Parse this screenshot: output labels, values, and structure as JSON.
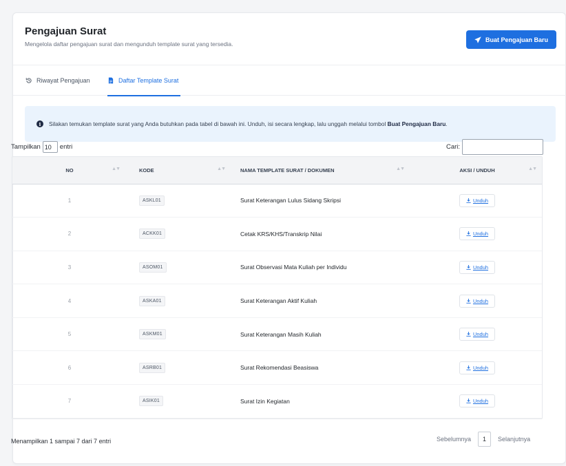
{
  "header": {
    "title": "Pengajuan Surat",
    "subtitle": "Mengelola daftar pengajuan surat dan mengunduh template surat yang tersedia.",
    "new_button_label": "Buat Pengajuan Baru"
  },
  "tabs": [
    {
      "label": "Riwayat Pengajuan",
      "icon": "history-icon",
      "active": false
    },
    {
      "label": "Daftar Template Surat",
      "icon": "document-icon",
      "active": true
    }
  ],
  "alert": {
    "text": "Silakan temukan template surat yang Anda butuhkan pada tabel di bawah ini. Unduh, isi secara lengkap, lalu unggah melalui tombol ",
    "highlight": "Buat Pengajuan Baru",
    "suffix": "."
  },
  "table_controls": {
    "show_label": "Tampilkan",
    "page_length": "10",
    "entries_label": "entri",
    "search_label": "Cari:",
    "search_value": ""
  },
  "table": {
    "columns": [
      "NO",
      "KODE",
      "NAMA TEMPLATE SURAT / DOKUMEN",
      "AKSI / UNDUH"
    ],
    "rows": [
      {
        "no": "1",
        "kode": "ASKL01",
        "nama": "Surat Keterangan Lulus Sidang Skripsi",
        "aksi": "Unduh"
      },
      {
        "no": "2",
        "kode": "ACKK01",
        "nama": "Cetak KRS/KHS/Transkrip Nilai",
        "aksi": "Unduh"
      },
      {
        "no": "3",
        "kode": "ASOM01",
        "nama": "Surat Observasi Mata Kuliah per Individu",
        "aksi": "Unduh"
      },
      {
        "no": "4",
        "kode": "ASKA01",
        "nama": "Surat Keterangan Aktif Kuliah",
        "aksi": "Unduh"
      },
      {
        "no": "5",
        "kode": "ASKM01",
        "nama": "Surat Keterangan Masih Kuliah",
        "aksi": "Unduh"
      },
      {
        "no": "6",
        "kode": "ASRB01",
        "nama": "Surat Rekomendasi Beasiswa",
        "aksi": "Unduh"
      },
      {
        "no": "7",
        "kode": "ASIK01",
        "nama": "Surat Izin Kegiatan",
        "aksi": "Unduh"
      }
    ]
  },
  "footer": {
    "info": "Menampilkan 1 sampai 7 dari 7 entri",
    "prev_label": "Sebelumnya",
    "current_page": "1",
    "next_label": "Selanjutnya"
  },
  "colors": {
    "primary": "#1e6fe0",
    "alert_bg": "#eaf3fd",
    "header_row_bg": "#f3f4f6"
  }
}
